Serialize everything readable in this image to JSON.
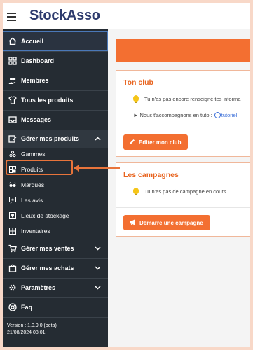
{
  "app": {
    "logo": "StockAsso"
  },
  "sidebar": {
    "items": [
      {
        "label": "Accueil",
        "icon": "home-icon"
      },
      {
        "label": "Dashboard",
        "icon": "dashboard-icon"
      },
      {
        "label": "Membres",
        "icon": "members-icon"
      },
      {
        "label": "Tous les produits",
        "icon": "tshirt-icon"
      },
      {
        "label": "Messages",
        "icon": "inbox-icon"
      },
      {
        "label": "Gérer mes produits",
        "icon": "box-edit-icon"
      }
    ],
    "sub_items": [
      {
        "label": "Gammes",
        "icon": "grid-dots-icon"
      },
      {
        "label": "Produits",
        "icon": "products-icon"
      },
      {
        "label": "Marques",
        "icon": "glasses-icon"
      },
      {
        "label": "Les avis",
        "icon": "reviews-icon"
      },
      {
        "label": "Lieux de stockage",
        "icon": "location-icon"
      },
      {
        "label": "Inventaires",
        "icon": "inventory-icon"
      }
    ],
    "sections": [
      {
        "label": "Gérer mes ventes",
        "icon": "cart-icon"
      },
      {
        "label": "Gérer mes achats",
        "icon": "bag-icon"
      },
      {
        "label": "Paramètres",
        "icon": "gear-icon"
      },
      {
        "label": "Faq",
        "icon": "help-icon"
      }
    ],
    "version": "Version : 1.0.9.0 (beta)",
    "version_date": "21/08/2024 08:01"
  },
  "main": {
    "club_card": {
      "title": "Ton club",
      "info": "Tu n'as pas encore renseigné tes informa",
      "help_prefix": "► Nous t'accompagnons en tuto :",
      "help_link": "tutoriel",
      "button": "Editer mon club"
    },
    "campaigns_card": {
      "title": "Les campagnes",
      "info": "Tu n'as pas de campagne en cours",
      "button": "Démarre une campagne"
    }
  },
  "colors": {
    "accent": "#f36f31",
    "sidebar_bg": "#252c33",
    "highlight": "#e8743b",
    "logo": "#2e3b6e"
  }
}
